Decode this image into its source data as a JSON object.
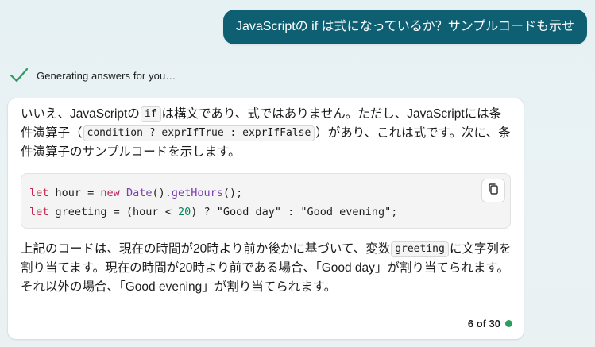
{
  "user_message": {
    "text": "JavaScriptの if は式になっているか？サンプルコードも示せ"
  },
  "status": {
    "text": "Generating answers for you…",
    "icon": "checkmark-icon",
    "color": "#2e9b5f"
  },
  "answer": {
    "intro": {
      "part1": "いいえ、JavaScriptの",
      "code1": "if",
      "part2": "は構文であり、式ではありません。ただし、JavaScriptには条件演算子（",
      "code2": "condition ? exprIfTrue : exprIfFalse",
      "part3": "）があり、これは式です。次に、条件演算子のサンプルコードを示します。"
    },
    "code": {
      "line1": {
        "kw": "let",
        "rest1": " hour = ",
        "kw2": "new",
        "sp": " ",
        "fn1": "Date",
        "punct1": "().",
        "fn2": "getHours",
        "punct2": "();"
      },
      "line2": {
        "kw": "let",
        "rest1": " greeting = (hour < ",
        "num": "20",
        "rest2": ") ? ",
        "str1": "\"Good day\"",
        "rest3": " : ",
        "str2": "\"Good evening\"",
        "end": ";"
      },
      "copy_icon": "copy-icon"
    },
    "explanation": {
      "part1": "上記のコードは、現在の時間が20時より前か後かに基づいて、変数",
      "code": "greeting",
      "part2": "に文字列を割り当てます。現在の時間が20時より前である場合、「Good day」が割り当てられます。それ以外の場合、「Good evening」が割り当てられます。"
    }
  },
  "footer": {
    "count_text": "6 of 30",
    "dot_color": "#2e9b5f"
  },
  "colors": {
    "user_bubble": "#0f5f73",
    "accent_green": "#2e9b5f"
  }
}
